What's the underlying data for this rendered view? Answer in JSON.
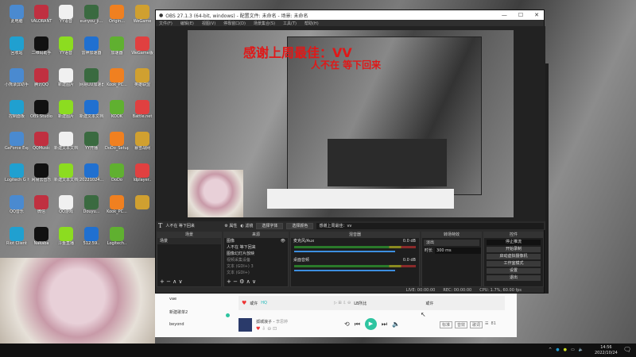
{
  "desktop": {
    "icons": [
      "此电脑",
      "VALORANT",
      "YY语音",
      "eunyou_ji...",
      "Origin...",
      "WeGame",
      "回收站",
      "二维码助手",
      "YY语音",
      "雷神加速器",
      "加速器",
      "WeGame版",
      "小熊录屏助手",
      "腾讯QQ",
      "新建图片",
      "网易UU加速器",
      "Kook_PC...",
      "英雄联盟",
      "控制面板",
      "OBS Studio",
      "新建图片",
      "新建文本文档",
      "KOOK",
      "Battle.net",
      "GeForce Experience",
      "QQMusic",
      "新建文本文档",
      "YY开播",
      "DoDo_Setup",
      "暴雪战网",
      "Logitech G HUB",
      "网易云音乐",
      "新建文本文档",
      "20221024...",
      "DoDo",
      "ldplayer..",
      "QQ音乐",
      "微信",
      "QQ游戏",
      "Douyu...",
      "Kook_PC...",
      "",
      "Riot Client",
      "Nakaba",
      "斗鱼直播",
      "512.59..",
      "Logitech.."
    ]
  },
  "obs": {
    "title": "OBS 27.1.3 (64-bit, windows) - 配置文件: 未命名 - 场景: 未命名",
    "menu": [
      "文件(F)",
      "编辑(E)",
      "视图(V)",
      "停靠窗口(D)",
      "场景集合(S)",
      "工具(T)",
      "帮助(H)"
    ],
    "overlay_text": "感谢上周最佳：VV",
    "overlay_text2": "人不在 等下回来",
    "toolbar": {
      "source_name": "人不在 等下回来",
      "properties": "属性",
      "filters": "滤镜",
      "select_font": "选择字体",
      "select_color": "选择颜色",
      "text_value": "感谢上周最佳：vv"
    },
    "docks": {
      "scenes": "场景",
      "sources": "来源",
      "mixer": "混音器",
      "transitions": "转场特效",
      "controls": "控件"
    },
    "scenes": [
      "场景"
    ],
    "sources": [
      "图像",
      "人不在 等下回来",
      "图像幻灯片放映",
      "视频采集设备",
      "文本 (GDI+) 3",
      "文本 (GDI+)"
    ],
    "mixer": [
      {
        "name": "麦克风/Aux",
        "db": "0.0 dB"
      },
      {
        "name": "桌面音频",
        "db": "0.0 dB"
      }
    ],
    "transition": {
      "type": "淡出",
      "duration_label": "时长",
      "duration": "300 ms"
    },
    "controls": [
      "停止推流",
      "开始录制",
      "启动虚拟摄像机",
      "工作室模式",
      "设置",
      "退出"
    ],
    "status": {
      "live": "LIVE: 00:00:00",
      "rec": "REC: 00:00:00",
      "cpu": "CPU: 1.7%, 60.00 fps"
    }
  },
  "music": {
    "playlists": [
      "vae",
      "新建歌单2",
      "beyond"
    ],
    "track_row": {
      "title": "或许",
      "badge": "HQ",
      "artist": "LB所比",
      "album": "或许"
    },
    "now_playing": {
      "title": "孤城浪子",
      "artist": "李思婷"
    },
    "right_labels": [
      "标准",
      "音效",
      "歌词"
    ],
    "queue_count": "81"
  },
  "taskbar": {
    "time": "14:56",
    "date": "2022/10/24"
  }
}
